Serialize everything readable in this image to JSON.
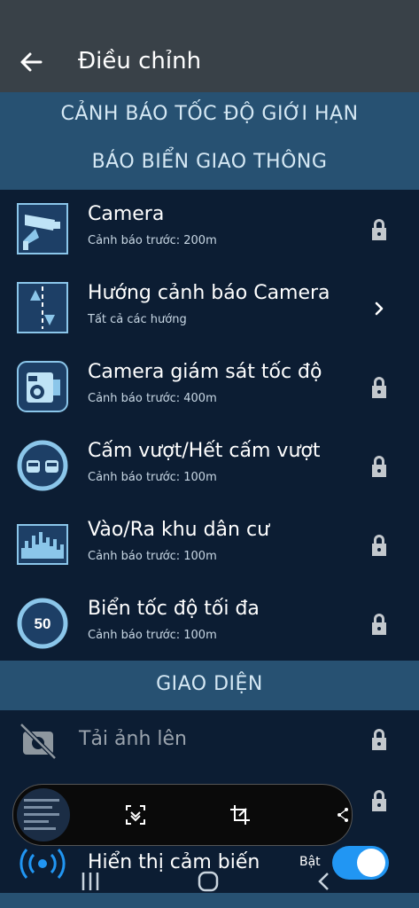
{
  "header": {
    "title": "Điều chỉnh"
  },
  "section_speed": {
    "line1": "CẢNH BÁO TỐC ĐỘ GIỚI HẠN",
    "line2": "BÁO BIỂN GIAO THÔNG"
  },
  "items": [
    {
      "title": "Camera",
      "subtitle": "Cảnh báo trước: 200m",
      "icon": "camera-icon",
      "right": "lock"
    },
    {
      "title": "Hướng cảnh báo Camera",
      "subtitle": "Tất cả các hướng",
      "icon": "direction-icon",
      "right": "chevron"
    },
    {
      "title": "Camera giám sát tốc độ",
      "subtitle": "Cảnh báo trước: 400m",
      "icon": "speed-camera-icon",
      "right": "lock"
    },
    {
      "title": "Cấm vượt/Hết cấm vượt",
      "subtitle": "Cảnh báo trước: 100m",
      "icon": "no-overtaking-icon",
      "right": "lock"
    },
    {
      "title": "Vào/Ra khu dân cư",
      "subtitle": "Cảnh báo trước: 100m",
      "icon": "city-icon",
      "right": "lock"
    },
    {
      "title": "Biển tốc độ tối đa",
      "subtitle": "Cảnh báo trước: 100m",
      "icon": "speed-limit-icon",
      "right": "lock",
      "badge": "50"
    }
  ],
  "section_ui": {
    "title": "GIAO DIỆN"
  },
  "ui_items": [
    {
      "title": "Tải ảnh lên",
      "icon": "no-image-icon",
      "right": "lock"
    },
    {
      "title": "Hiển thị cảm biến",
      "icon": "sensor-icon",
      "toggle_label": "Bật",
      "toggle_on": true
    }
  ],
  "colors": {
    "accent": "#2196f3",
    "section_bg": "#275172",
    "page_bg": "#0c1d33",
    "topbar": "#394148"
  }
}
